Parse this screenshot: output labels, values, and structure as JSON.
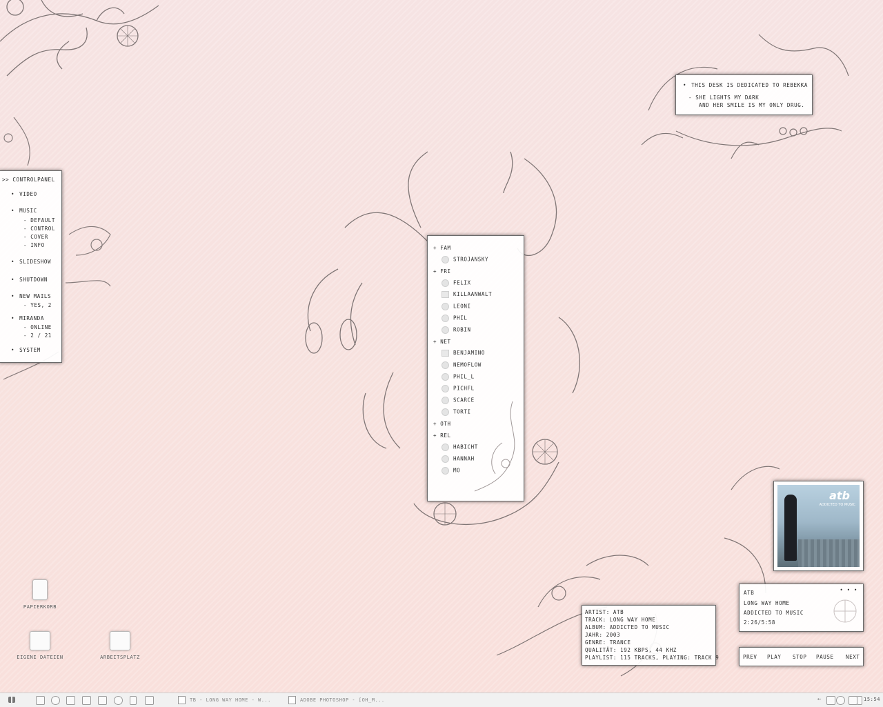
{
  "dedication": {
    "line1": "This desk is dedicated to Rebekka",
    "line2": "- she lights my dark",
    "line3": "and her smile is my only drug."
  },
  "controlpanel": {
    "title": ">> controlpanel",
    "items": [
      {
        "label": "video"
      },
      {
        "label": "music"
      },
      {
        "label": "- default"
      },
      {
        "label": "- control"
      },
      {
        "label": "- cover"
      },
      {
        "label": "- info"
      },
      {
        "label": "slideshow"
      },
      {
        "label": "shutdown"
      },
      {
        "label": "new mails"
      },
      {
        "label": "- yes, 2"
      },
      {
        "label": "miranda"
      },
      {
        "label": "- online"
      },
      {
        "label": "- 2 / 21"
      },
      {
        "label": "system"
      }
    ]
  },
  "contacts": {
    "groups": [
      {
        "name": "fam",
        "members": [
          "strojansky"
        ]
      },
      {
        "name": "fri",
        "members": [
          "felix",
          "killaanwalt",
          "leoni",
          "phil",
          "robin"
        ]
      },
      {
        "name": "net",
        "members": [
          "benjamino",
          "nemoflow",
          "phil_l",
          "pichfl",
          "scarce",
          "torti"
        ]
      },
      {
        "name": "oth",
        "members": []
      },
      {
        "name": "rel",
        "members": [
          "habicht",
          "hannah",
          "mo"
        ]
      }
    ]
  },
  "player": {
    "album_art_text": "atb",
    "album_art_sub": "addicted to music",
    "artist": "atb",
    "track": "long way home",
    "album": "addicted to music",
    "time": "2:26/5:58",
    "dots": "• • •",
    "controls": {
      "prev": "prev",
      "play": "play",
      "stop": "stop",
      "pause": "pause",
      "next": "next"
    }
  },
  "trackinfo": {
    "artist": "artist: atb",
    "track": "track: long way home",
    "album": "album: addicted to music",
    "year": "jahr: 2003",
    "genre": "genre: trance",
    "quality": "qualität: 192 kbps, 44 khz",
    "playlist": "playlist: 115 tracks, playing: track 9"
  },
  "desktop": {
    "icons": [
      {
        "label": "papierkorb"
      },
      {
        "label": "eigene dateien"
      },
      {
        "label": "arbeitsplatz"
      }
    ]
  },
  "taskbar": {
    "task1": "tb - long way home - w...",
    "task2": "adobe photoshop - [oh_m...",
    "clock": "15:54"
  }
}
